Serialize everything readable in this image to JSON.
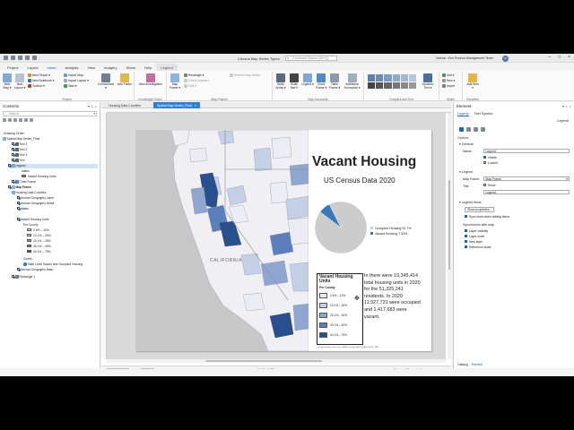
{
  "window": {
    "title": "Census Map Series Types",
    "command_search_placeholder": "Command Search (Alt+Q)",
    "user": "Valeria · Esri Product Management Team",
    "avatar_initials": "VK"
  },
  "tabs": [
    "Project",
    "Layout",
    "Insert",
    "Analysis",
    "View",
    "Imagery",
    "Share",
    "Help",
    "Legend"
  ],
  "active_tab": "Insert",
  "ribbon": {
    "project": {
      "label": "Project",
      "new_map": "New Map ▾",
      "new_layout": "New Layout ▾",
      "new_report": "New Report ▾",
      "new_notebook": "New Notebook ▾",
      "toolbox": "Toolbox ▾",
      "import_map": "Import Map",
      "import_layout": "Import Layout ▾",
      "task": "Task ▾",
      "connections": "Connections ▾",
      "add_folder": "Add Folder"
    },
    "knowledge": {
      "label": "Knowledge Graph",
      "new_investigation": "New Investigation"
    },
    "map_frames": {
      "label": "Map Frames",
      "map_frame": "Map Frame ▾",
      "rectangle": "Rectangle ▾",
      "extent_indicator": "Extent Indicator",
      "grid": "Grid ▾",
      "refresh_map_series": "Refresh Map Series"
    },
    "map_surrounds": {
      "label": "Map Surrounds",
      "north_arrow": "North Arrow ▾",
      "scale_bar": "Scale Bar ▾",
      "legend": "Legend ▾",
      "chart_frame": "Chart Frame ▾",
      "table_frame": "Table Frame ▾",
      "additional_surrounds": "Additional Surrounds ▾"
    },
    "graphics": {
      "label": "Graphics and Text",
      "dynamic_text": "Dynamic Text ▾"
    },
    "styles": {
      "label": "Styles",
      "add": "Add ▾",
      "new": "New ▾",
      "import": "Import"
    },
    "favorites": {
      "label": "Favorites",
      "add_item": "Add Item ▾"
    }
  },
  "contents": {
    "title": "Contents",
    "search_placeholder": "Search",
    "drawing_order": "Drawing Order",
    "items": [
      {
        "label": "Spatial Map Series_Final",
        "checked": true
      },
      {
        "label": "Text 3",
        "checked": true
      },
      {
        "label": "Text 2",
        "checked": true
      },
      {
        "label": "Text 1",
        "checked": true
      },
      {
        "label": "Text",
        "checked": true
      },
      {
        "label": "Legend",
        "checked": true
      },
      {
        "label": "states",
        "checked": false
      },
      {
        "label": "Vacant Housing Units",
        "checked": true
      },
      {
        "label": "Chart Frame",
        "checked": true
      },
      {
        "label": "Map Frame",
        "checked": true
      },
      {
        "label": "Housing Data Counties",
        "checked": false
      },
      {
        "label": "Human Geography Label",
        "checked": true
      },
      {
        "label": "Human Geography Detail",
        "checked": true
      },
      {
        "label": "states",
        "checked": true
      },
      {
        "label": "Vacant Housing Units",
        "checked": true
      },
      {
        "label": "Per County",
        "checked": false
      },
      {
        "label": "Charts",
        "checked": false
      },
      {
        "label": "State Level Vacant and Occupied Housing",
        "checked": false
      },
      {
        "label": "Human Geography Base",
        "checked": true
      },
      {
        "label": "Rectangle 1",
        "checked": true
      }
    ],
    "classes": [
      "2.6% – 10%",
      "10.1% – 20%",
      "20.1% – 30%",
      "30.1% – 40%",
      "40.1% – 75%"
    ]
  },
  "view": {
    "tabs": [
      "Housing Data Counties",
      "Spatial Map Series_Final"
    ],
    "active_tab": "Spatial Map Series_Final",
    "scale": "1:6,166,300",
    "zoom": "36%",
    "coords": "8.145 , 2.336",
    "selected": "Selected Elements: 1"
  },
  "layout": {
    "title": "Vacant Housing",
    "subtitle": "US Census Data 2020",
    "map_label": "CALIFORNIA",
    "pie": {
      "occupied_label": "Occupied Housing 92.7%",
      "vacant_label": "Vacant Housing 7.33%"
    },
    "legend": {
      "title": "Vacant Housing Units",
      "subtitle": "Per County",
      "items": [
        "2.6% – 10%",
        "10.1% – 20%",
        "20.1% – 30%",
        "30.1% – 40%",
        "40.1% – 75%"
      ]
    },
    "statement": "In there were 19,345,414 total housing units in 2020 for the 51,325,241 residents. In 2020 11,927,731 were occupied and 1,417,683 were vacant.",
    "credits": "California State Parks, Esri, HERE, Garmin, FAO, NOAA, USGS, EPA"
  },
  "element_pane": {
    "title": "Element",
    "tabs": [
      "Legend",
      "Text Symbol"
    ],
    "active_tab": "Legend",
    "element_name": "Legend",
    "options": "Options",
    "general": "General",
    "name_label": "Name",
    "name_value": "Legend",
    "visible": "Visible",
    "locked": "Locked",
    "legend_section": "Legend",
    "map_frame_label": "Map Frame",
    "map_frame_value": "Map Frame",
    "title_label": "Title",
    "show": "Show",
    "title_value": "Legend",
    "legend_items": "Legend Items",
    "show_properties": "Show properties...",
    "sync_fonts": "Sync fonts when adding items",
    "sync_with_map": "Synchronize with map",
    "layer_visibility": "Layer visibility",
    "layer_order": "Layer order",
    "new_layer": "New layer",
    "reference_scale": "Reference scale",
    "bottom_tabs": [
      "Catalog",
      "Element"
    ],
    "bottom_active": "Element"
  },
  "colors": {
    "accent": "#1467c0",
    "class_1": "#ececf4",
    "class_2": "#c4d0e6",
    "class_3": "#8fa6d0",
    "class_4": "#5b7fba",
    "class_5": "#28508f",
    "pie_occupied": "#cccccc",
    "pie_vacant": "#3a78b8"
  },
  "chart_data": {
    "type": "pie",
    "categories": [
      "Occupied Housing",
      "Vacant Housing"
    ],
    "values": [
      92.7,
      7.33
    ]
  }
}
